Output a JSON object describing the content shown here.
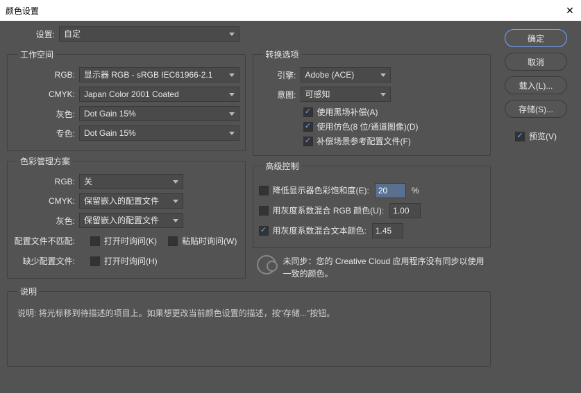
{
  "title": "颜色设置",
  "settings_label": "设置:",
  "settings_value": "自定",
  "workspace": {
    "legend": "工作空间",
    "rgb_label": "RGB:",
    "rgb_value": "显示器 RGB - sRGB IEC61966-2.1",
    "cmyk_label": "CMYK:",
    "cmyk_value": "Japan Color 2001 Coated",
    "gray_label": "灰色:",
    "gray_value": "Dot Gain 15%",
    "spot_label": "专色:",
    "spot_value": "Dot Gain 15%"
  },
  "policy": {
    "legend": "色彩管理方案",
    "rgb_label": "RGB:",
    "rgb_value": "关",
    "cmyk_label": "CMYK:",
    "cmyk_value": "保留嵌入的配置文件",
    "gray_label": "灰色:",
    "gray_value": "保留嵌入的配置文件",
    "mismatch_label": "配置文件不匹配:",
    "mismatch_open": "打开时询问(K)",
    "mismatch_paste": "粘贴时询问(W)",
    "missing_label": "缺少配置文件:",
    "missing_open": "打开时询问(H)"
  },
  "conversion": {
    "legend": "转换选项",
    "engine_label": "引擎:",
    "engine_value": "Adobe (ACE)",
    "intent_label": "意图:",
    "intent_value": "可感知",
    "black_point": "使用黑场补偿(A)",
    "dither": "使用仿色(8 位/通道图像)(D)",
    "compensate": "补偿场景参考配置文件(F)"
  },
  "advanced": {
    "legend": "高级控制",
    "desaturate": "降低显示器色彩饱和度(E):",
    "desaturate_value": "20",
    "blend_rgb": "用灰度系数混合 RGB 颜色(U):",
    "blend_rgb_value": "1.00",
    "blend_text": "用灰度系数混合文本颜色:",
    "blend_text_value": "1.45",
    "percent": "%"
  },
  "sync_text": "未同步：您的 Creative Cloud 应用程序没有同步以使用一致的颜色。",
  "description": {
    "legend": "说明",
    "text": "说明: 将光标移到待描述的项目上。如果想更改当前颜色设置的描述，按\"存储...\"按钮。"
  },
  "buttons": {
    "ok": "确定",
    "cancel": "取消",
    "load": "载入(L)...",
    "save": "存储(S)..."
  },
  "preview": "预览(V)"
}
